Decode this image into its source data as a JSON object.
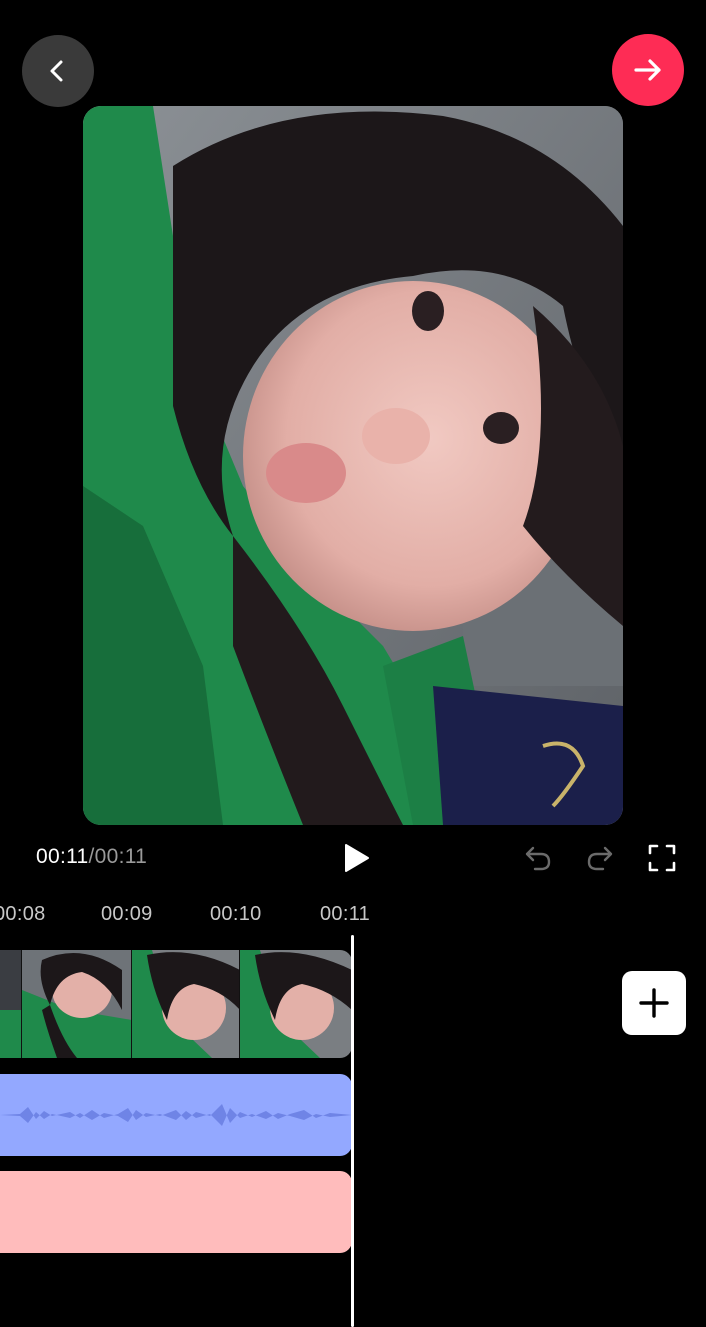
{
  "header": {
    "back_icon": "chevron-left-icon",
    "next_icon": "arrow-right-icon",
    "accent_color": "#fe2c55"
  },
  "player": {
    "current_time": "00:11",
    "separator": "/",
    "total_time": "00:11",
    "play_icon": "play-icon",
    "undo_icon": "undo-icon",
    "redo_icon": "redo-icon",
    "fullscreen_icon": "fullscreen-icon"
  },
  "timeline": {
    "ruler": [
      "00:08",
      "00:09",
      "00:10",
      "00:11"
    ],
    "tracks": {
      "video_color": "#222222",
      "audio_color": "#93a8ff",
      "text_color": "#ffbcbc"
    },
    "add_icon": "plus-icon"
  }
}
